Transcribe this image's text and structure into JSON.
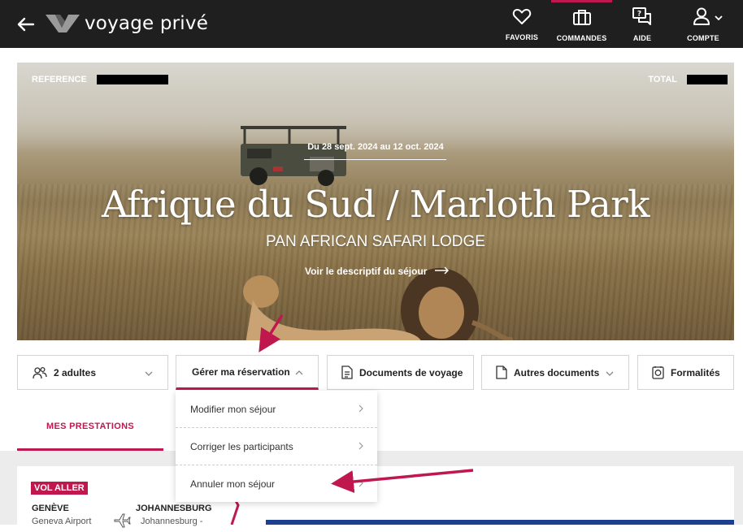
{
  "header": {
    "back_icon": "arrow-left-icon",
    "logo_text": "voyage privé",
    "nav": [
      {
        "label": "FAVORIS",
        "icon": "heart-icon"
      },
      {
        "label": "COMMANDES",
        "icon": "briefcase-icon"
      },
      {
        "label": "AIDE",
        "icon": "chat-help-icon"
      },
      {
        "label": "COMPTE",
        "icon": "user-icon"
      }
    ]
  },
  "hero": {
    "reference_label": "REFERENCE",
    "total_label": "TOTAL",
    "dates": "Du 28 sept. 2024 au 12 oct. 2024",
    "title": "Afrique du Sud / Marloth Park",
    "subtitle": "PAN AFRICAN SAFARI LODGE",
    "link": "Voir le descriptif du séjour"
  },
  "actions": {
    "travelers": "2 adultes",
    "manage": "Gérer ma réservation",
    "travel_docs": "Documents de voyage",
    "other_docs": "Autres documents",
    "formalities": "Formalités"
  },
  "manage_menu": {
    "items": [
      "Modifier mon séjour",
      "Corriger les participants",
      "Annuler mon séjour"
    ]
  },
  "tabs": {
    "services": "MES PRESTATIONS"
  },
  "flight": {
    "badge": "VOL ALLER",
    "from_city": "GENÈVE",
    "from_airport": "Geneva Airport",
    "to_city": "JOHANNESBURG",
    "to_airport": "Johannesburg -"
  },
  "colors": {
    "accent": "#c0174f",
    "topbar": "#1f1f1f",
    "flight_bar": "#1d3f8f"
  }
}
